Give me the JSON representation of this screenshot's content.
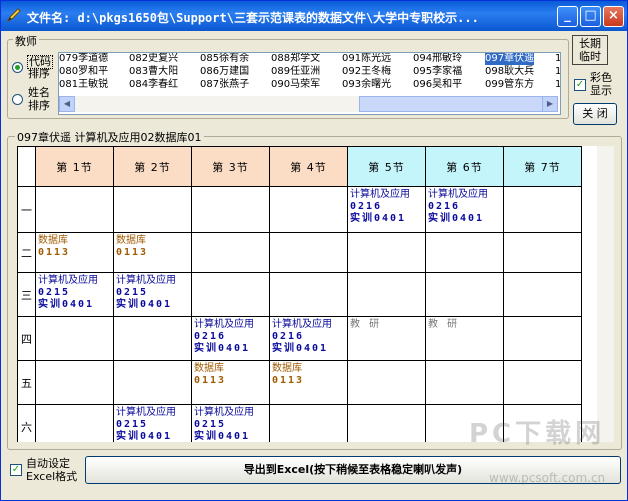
{
  "window": {
    "title": "文件名: d:\\pkgs1650包\\Support\\三套示范课表的数据文件\\大学中专职校示..."
  },
  "teacher_group": {
    "label": "教师",
    "radio_code": "代码\n排序",
    "radio_code_l1": "代码",
    "radio_code_l2": "排序",
    "radio_name_l1": "姓名",
    "radio_name_l2": "排序",
    "list_rows": [
      [
        "079李道德",
        "082史复兴",
        "085徐有余",
        "088郑学文",
        "091陈光远",
        "094邢敏玲",
        "097章伏遥",
        "1"
      ],
      [
        "080罗和平",
        "083曹大阳",
        "086万建国",
        "089任亚洲",
        "092王冬梅",
        "095李家福",
        "098耿大兵",
        "1"
      ],
      [
        "081王敏锐",
        "084李春红",
        "087张燕子",
        "090马荣军",
        "093余曙光",
        "096吴和平",
        "099管东方",
        "1"
      ]
    ],
    "selected": "097章伏遥"
  },
  "side": {
    "long_short_l1": "长期",
    "long_short_l2": "临时",
    "color_l1": "彩色",
    "color_l2": "显示",
    "close": "关 闭"
  },
  "schedule": {
    "group_label": "097章伏遥 计算机及应用02数据库01",
    "columns": [
      "第 1节",
      "第 2节",
      "第 3节",
      "第 4节",
      "第 5节",
      "第 6节",
      "第 7节"
    ],
    "rows": [
      "一",
      "二",
      "三",
      "四",
      "五",
      "六"
    ],
    "cells": {
      "r0c4": [
        "计算机及应用",
        "0216",
        "实训0401"
      ],
      "r0c5": [
        "计算机及应用",
        "0216",
        "实训0401"
      ],
      "r1c0": [
        "数据库",
        "0113"
      ],
      "r1c1": [
        "数据库",
        "0113"
      ],
      "r2c0": [
        "计算机及应用",
        "0215",
        "实训0401"
      ],
      "r2c1": [
        "计算机及应用",
        "0215",
        "实训0401"
      ],
      "r3c2": [
        "计算机及应用",
        "0216",
        "实训0401"
      ],
      "r3c3": [
        "计算机及应用",
        "0216",
        "实训0401"
      ],
      "r3c4": [
        "教 研"
      ],
      "r3c5": [
        "教 研"
      ],
      "r4c2": [
        "数据库",
        "0113"
      ],
      "r4c3": [
        "数据库",
        "0113"
      ],
      "r5c1": [
        "计算机及应用",
        "0215",
        "实训0401"
      ],
      "r5c2": [
        "计算机及应用",
        "0215",
        "实训0401"
      ]
    }
  },
  "bottom": {
    "auto_l1": "自动设定",
    "auto_l2": "Excel格式",
    "export": "导出到Excel(按下稍候至表格稳定喇叭发声)"
  },
  "watermark": {
    "brand": "PC下载网",
    "url": "www.pcsoft.com.cn"
  },
  "colors": {
    "header_peach": "#fbdcc4",
    "header_cyan": "#c4f5fb",
    "course_blue": "#0a0a9c",
    "course_brown": "#a05a00",
    "selection": "#316ac5"
  }
}
